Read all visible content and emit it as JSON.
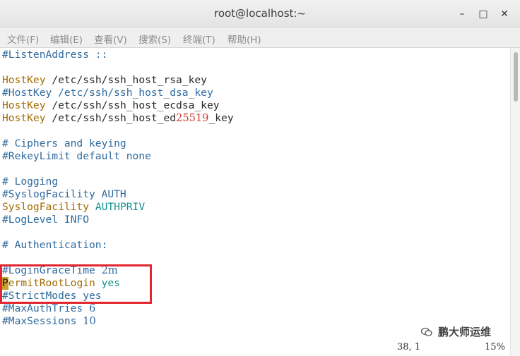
{
  "window": {
    "title": "root@localhost:~"
  },
  "menu": [
    "文件(F)",
    "编辑(E)",
    "查看(V)",
    "搜索(S)",
    "终端(T)",
    "帮助(H)"
  ],
  "lines": {
    "l0": "#ListenAddress ::",
    "hostkey1_key": "HostKey",
    "hostkey1_val": "/etc/ssh/ssh_host_rsa_key",
    "hostkey2": "#HostKey /etc/ssh/ssh_host_dsa_key",
    "hostkey3_key": "HostKey",
    "hostkey3_val": "/etc/ssh/ssh_host_ecdsa_key",
    "hostkey4_key": "HostKey",
    "hostkey4_val_a": "/etc/ssh/ssh_host_ed",
    "hostkey4_val_b": "25519",
    "hostkey4_val_c": "_key",
    "ciphers": "# Ciphers and keying",
    "rekey": "#RekeyLimit default none",
    "logging": "# Logging",
    "syslog_comment": "#SyslogFacility AUTH",
    "syslog_key": "SyslogFacility",
    "syslog_val": "AUTHPRIV",
    "loglevel": "#LogLevel INFO",
    "auth": "# Authentication:",
    "grace_a": "#LoginGraceTime ",
    "grace_b": "2m",
    "permit_cursor": "P",
    "permit_key": "ermitRootLogin",
    "permit_val": "yes",
    "strict": "#StrictModes yes",
    "maxauth_a": "#MaxAuthTries ",
    "maxauth_b": "6",
    "maxsess_a": "#MaxSessions ",
    "maxsess_b": "10"
  },
  "status": {
    "position": "38, 1",
    "percent": "15%"
  },
  "watermark": "鹏大师运维"
}
